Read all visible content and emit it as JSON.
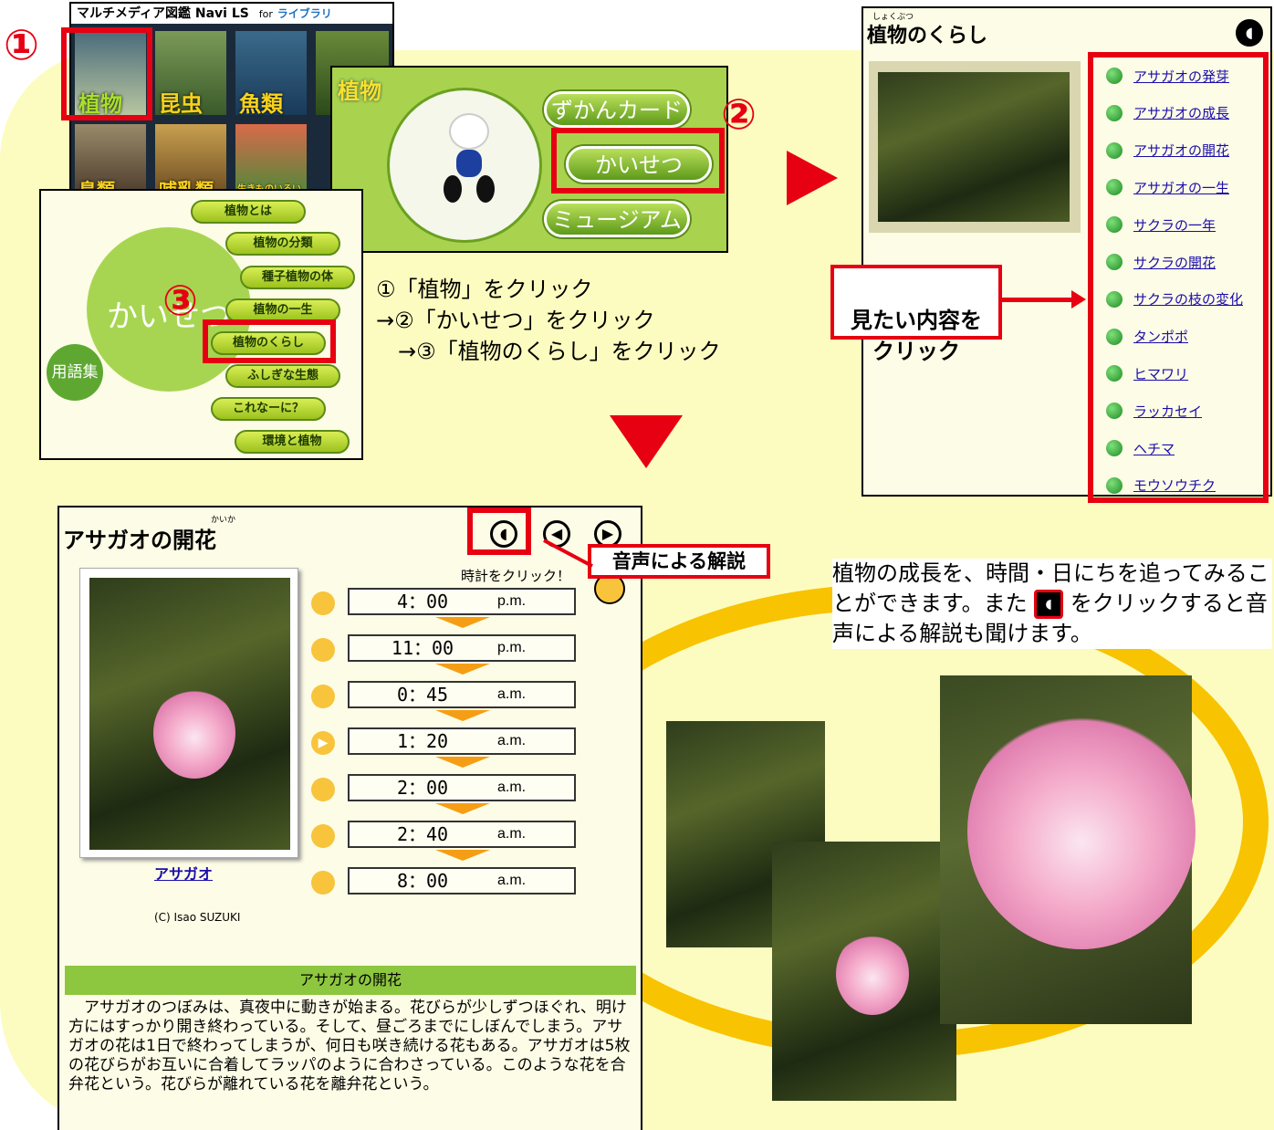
{
  "app": {
    "title": "マルチメディア図鑑 Navi LS",
    "for_label": "for",
    "library": "ライブラリ"
  },
  "categories": [
    {
      "label": "植物",
      "selected": true
    },
    {
      "label": "昆虫",
      "selected": false
    },
    {
      "label": "魚類",
      "selected": false
    },
    {
      "label": "鳥類",
      "selected": false
    },
    {
      "label": "哺乳類",
      "selected": false
    },
    {
      "label": "生きものいろいろ",
      "selected": false
    }
  ],
  "plant_menu": {
    "logo": "植物",
    "buttons": [
      "ずかんカード",
      "かいせつ",
      "ミュージアム"
    ]
  },
  "kaisetsu_menu": {
    "title": "かいせつ",
    "glossary": "用語集",
    "items": [
      "植物とは",
      "植物の分類",
      "種子植物の体",
      "植物の一生",
      "植物のくらし",
      "ふしぎな生態",
      "これなーに？",
      "環境と植物"
    ]
  },
  "steps": {
    "n1": "①",
    "n2": "②",
    "n3": "③",
    "line1": "①「植物」をクリック",
    "line2": "→②「かいせつ」をクリック",
    "line3": "→③「植物のくらし」をクリック"
  },
  "kurashi": {
    "ruby": "しょくぶつ",
    "title": "植物のくらし",
    "callout": "見たい内容を\nクリック",
    "links": [
      "アサガオの発芽",
      "アサガオの成長",
      "アサガオの開花",
      "アサガオの一生",
      "サクラの一年",
      "サクラの開花",
      "サクラの枝の変化",
      "タンポポ",
      "ヒマワリ",
      "ラッカセイ",
      "ヘチマ",
      "モウソウチク"
    ]
  },
  "kaika": {
    "ruby": "かいか",
    "title": "アサガオの開花",
    "audio_callout": "音声による解説",
    "clock_hint": "時計をクリック！",
    "times": [
      {
        "time": "4：00",
        "ampm": "p.m."
      },
      {
        "time": "11：00",
        "ampm": "p.m."
      },
      {
        "time": "0：45",
        "ampm": "a.m."
      },
      {
        "time": "1：20",
        "ampm": "a.m."
      },
      {
        "time": "2：00",
        "ampm": "a.m."
      },
      {
        "time": "2：40",
        "ampm": "a.m."
      },
      {
        "time": "8：00",
        "ampm": "a.m."
      }
    ],
    "photo_link": "アサガオ",
    "credit": "(C) Isao SUZUKI",
    "desc_title": "アサガオの開花",
    "desc_text": "　アサガオのつぼみは、真夜中に動きが始まる。花びらが少しずつほぐれ、明け方にはすっかり開き終わっている。そして、昼ごろまでにしぼんでしまう。アサガオの花は1日で終わってしまうが、何日も咲き続ける花もある。アサガオは5枚の花びらがお互いに合着してラッパのように合わさっている。このような花を合弁花という。花びらが離れている花を離弁花という。"
  },
  "caption": {
    "part1": "植物の成長を、時間・日にちを追ってみることができます。また",
    "part2": "をクリックすると音声による解説も聞けます。"
  },
  "colors": {
    "accent_red": "#e60012",
    "pale_yellow": "#fdfcc0",
    "green": "#8dc63f",
    "swoosh": "#f8c300"
  }
}
